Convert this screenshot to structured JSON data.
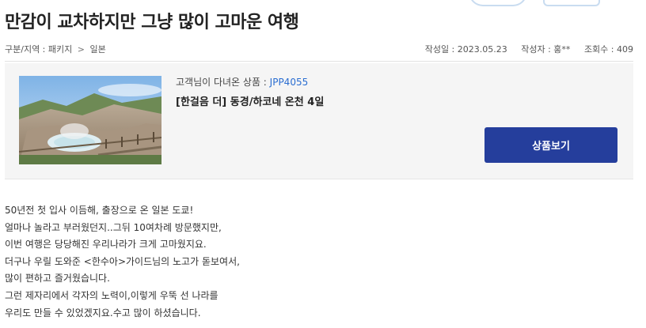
{
  "post": {
    "title": "만감이 교차하지만 그냥 많이 고마운 여행",
    "breadcrumb": {
      "category": "구분/지역 : 패키지",
      "separator": ">",
      "region": "일본"
    },
    "meta": {
      "date": "작성일 : 2023.05.23",
      "author": "작성자 : 홍**",
      "views": "조회수 : 409"
    }
  },
  "product": {
    "label": "고객님이 다녀온 상품 : ",
    "code": "JPP4055",
    "name": "[한걸음 더] 동경/하코네 온천 4일",
    "button_label": "상품보기",
    "thumbnail_icon": "hot-spring-landscape-photo"
  },
  "content": {
    "lines": [
      "50년전 첫 입사 이듬해, 출장으로 온 일본 도쿄!",
      "얼마나 놀라고 부러웠던지..그뒤 10여차례 방문했지만,",
      "이번 여행은 당당해진 우리나라가 크게 고마웠지요.",
      "더구나 우릴 도와준 <한수아>가이드님의 노고가 돋보여서,",
      "많이 편하고 즐거웠습니다.",
      "그런 제자리에서 각자의 노력이,이렇게 우뚝 선 나라를",
      "우리도 만들 수 있었겠지요.수고 많이 하셨습니다."
    ]
  },
  "colors": {
    "button_bg": "#253e9c",
    "code_link": "#2a6dd1",
    "panel_bg": "#f5f5f5"
  }
}
